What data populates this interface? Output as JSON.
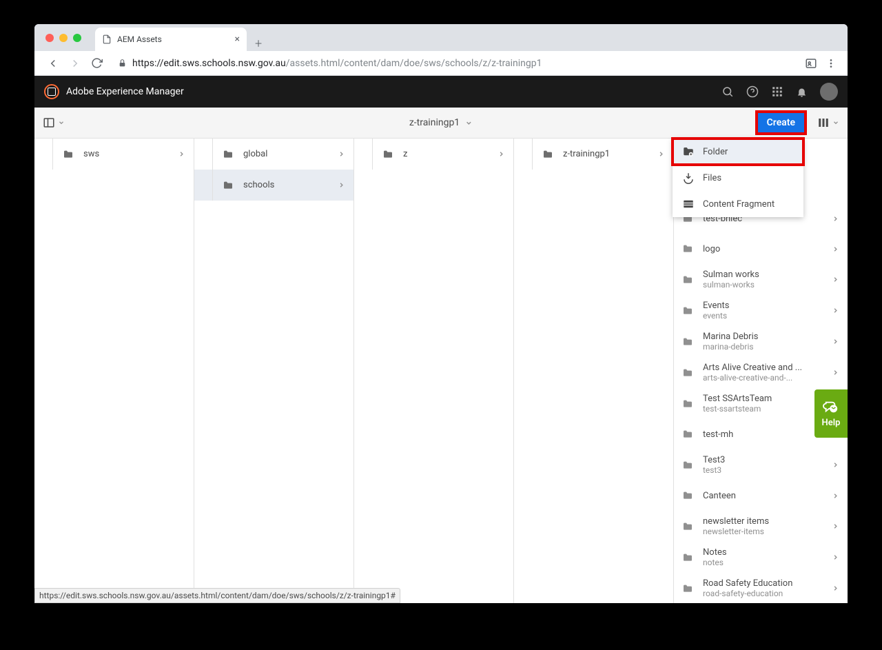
{
  "browser": {
    "tab_title": "AEM Assets",
    "url_host": "https://edit.sws.schools.nsw.gov.au",
    "url_path": "/assets.html/content/dam/doe/sws/schools/z/z-trainingp1",
    "status_url": "https://edit.sws.schools.nsw.gov.au/assets.html/content/dam/doe/sws/schools/z/z-trainingp1#"
  },
  "aem": {
    "product": "Adobe Experience Manager",
    "breadcrumb": "z-trainingp1",
    "create_label": "Create"
  },
  "dropdown": {
    "items": [
      {
        "label": "Folder",
        "highlighted": true
      },
      {
        "label": "Files",
        "highlighted": false
      },
      {
        "label": "Content Fragment",
        "highlighted": false
      }
    ]
  },
  "columns": [
    {
      "items": [
        {
          "label": "sws",
          "selected": false
        }
      ]
    },
    {
      "items": [
        {
          "label": "global",
          "selected": false
        },
        {
          "label": "schools",
          "selected": true
        }
      ]
    },
    {
      "items": [
        {
          "label": "z",
          "selected": false
        }
      ]
    },
    {
      "items": [
        {
          "label": "z-trainingp1",
          "selected": false
        }
      ]
    }
  ],
  "last_column": [
    {
      "primary": "test-bhiec",
      "secondary": ""
    },
    {
      "primary": "logo",
      "secondary": ""
    },
    {
      "primary": "Sulman works",
      "secondary": "sulman-works"
    },
    {
      "primary": "Events",
      "secondary": "events"
    },
    {
      "primary": "Marina Debris",
      "secondary": "marina-debris"
    },
    {
      "primary": "Arts Alive Creative and ...",
      "secondary": "arts-alive-creative-and-..."
    },
    {
      "primary": "Test SSArtsTeam",
      "secondary": "test-ssartsteam"
    },
    {
      "primary": "test-mh",
      "secondary": ""
    },
    {
      "primary": "Test3",
      "secondary": "test3"
    },
    {
      "primary": "Canteen",
      "secondary": ""
    },
    {
      "primary": "newsletter items",
      "secondary": "newsletter-items"
    },
    {
      "primary": "Notes",
      "secondary": "notes"
    },
    {
      "primary": "Road Safety Education",
      "secondary": "road-safety-education"
    }
  ],
  "help": {
    "label": "Help"
  }
}
